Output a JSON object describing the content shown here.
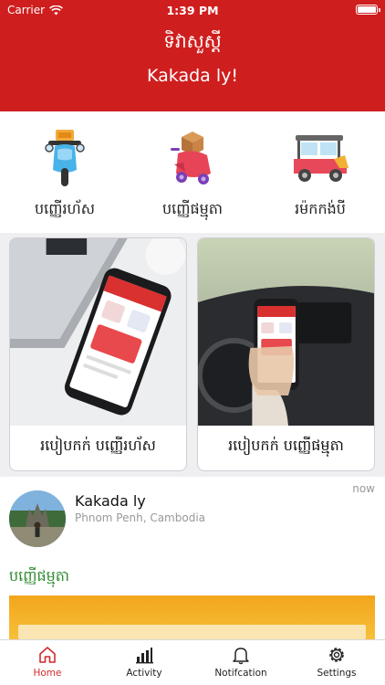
{
  "status_bar": {
    "carrier": "Carrier",
    "time": "1:39 PM"
  },
  "header": {
    "title": "ទិវាសួស្តី",
    "subtitle": "Kakada ly!"
  },
  "services": [
    {
      "label": "បញ្ញើរហ័ស",
      "icon": "scooter-icon"
    },
    {
      "label": "បញ្ញើផម្មុតា",
      "icon": "delivery-box-scooter-icon"
    },
    {
      "label": "រម៉កកង់បី",
      "icon": "tuk-tuk-icon"
    }
  ],
  "guides": [
    {
      "label": "របៀបកក់ បញ្ញើរហ័ស"
    },
    {
      "label": "របៀបកក់ បញ្ញើផម្មុតា"
    }
  ],
  "post": {
    "name": "Kakada ly",
    "location": "Phnom Penh, Cambodia",
    "time": "now",
    "category": "បញ្ញើផម្មុតា"
  },
  "tabs": [
    {
      "label": "Home",
      "icon": "home-icon",
      "active": true
    },
    {
      "label": "Activity",
      "icon": "bar-chart-icon",
      "active": false
    },
    {
      "label": "Notifcation",
      "icon": "bell-icon",
      "active": false
    },
    {
      "label": "Settings",
      "icon": "gear-icon",
      "active": false
    }
  ],
  "colors": {
    "brand_red": "#cf1e1e",
    "category_green": "#2f8b2f",
    "active_tab": "#d12a2a"
  }
}
